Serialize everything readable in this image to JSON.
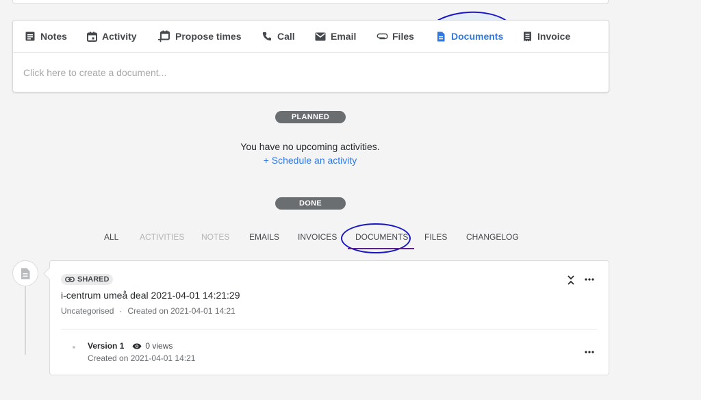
{
  "tabs": [
    {
      "label": "Notes",
      "icon": "notes-icon"
    },
    {
      "label": "Activity",
      "icon": "calendar-icon"
    },
    {
      "label": "Propose times",
      "icon": "calendar-plus-icon"
    },
    {
      "label": "Call",
      "icon": "phone-icon"
    },
    {
      "label": "Email",
      "icon": "envelope-icon"
    },
    {
      "label": "Files",
      "icon": "paperclip-icon"
    },
    {
      "label": "Documents",
      "icon": "document-icon",
      "active": true
    },
    {
      "label": "Invoice",
      "icon": "invoice-icon"
    }
  ],
  "document_input": {
    "placeholder": "Click here to create a document..."
  },
  "planned": {
    "badge": "PLANNED",
    "message": "You have no upcoming activities.",
    "link": "+ Schedule an activity"
  },
  "done": {
    "badge": "DONE"
  },
  "filters": [
    {
      "label": "ALL",
      "enabled": true
    },
    {
      "label": "ACTIVITIES",
      "enabled": false
    },
    {
      "label": "NOTES",
      "enabled": false
    },
    {
      "label": "EMAILS",
      "enabled": true
    },
    {
      "label": "INVOICES",
      "enabled": true
    },
    {
      "label": "DOCUMENTS",
      "enabled": true,
      "selected": true
    },
    {
      "label": "FILES",
      "enabled": true
    },
    {
      "label": "CHANGELOG",
      "enabled": true
    }
  ],
  "document": {
    "badge": "SHARED",
    "title": "i-centrum umeå deal 2021-04-01 14:21:29",
    "category": "Uncategorised",
    "created": "Created on 2021-04-01 14:21",
    "version": {
      "name": "Version 1",
      "views": "0 views",
      "created": "Created on 2021-04-01 14:21"
    }
  },
  "colors": {
    "accent": "#317ae2",
    "annotation": "#1a16c4",
    "badge_bg": "#6b6e70",
    "background": "#f4f4f4"
  }
}
